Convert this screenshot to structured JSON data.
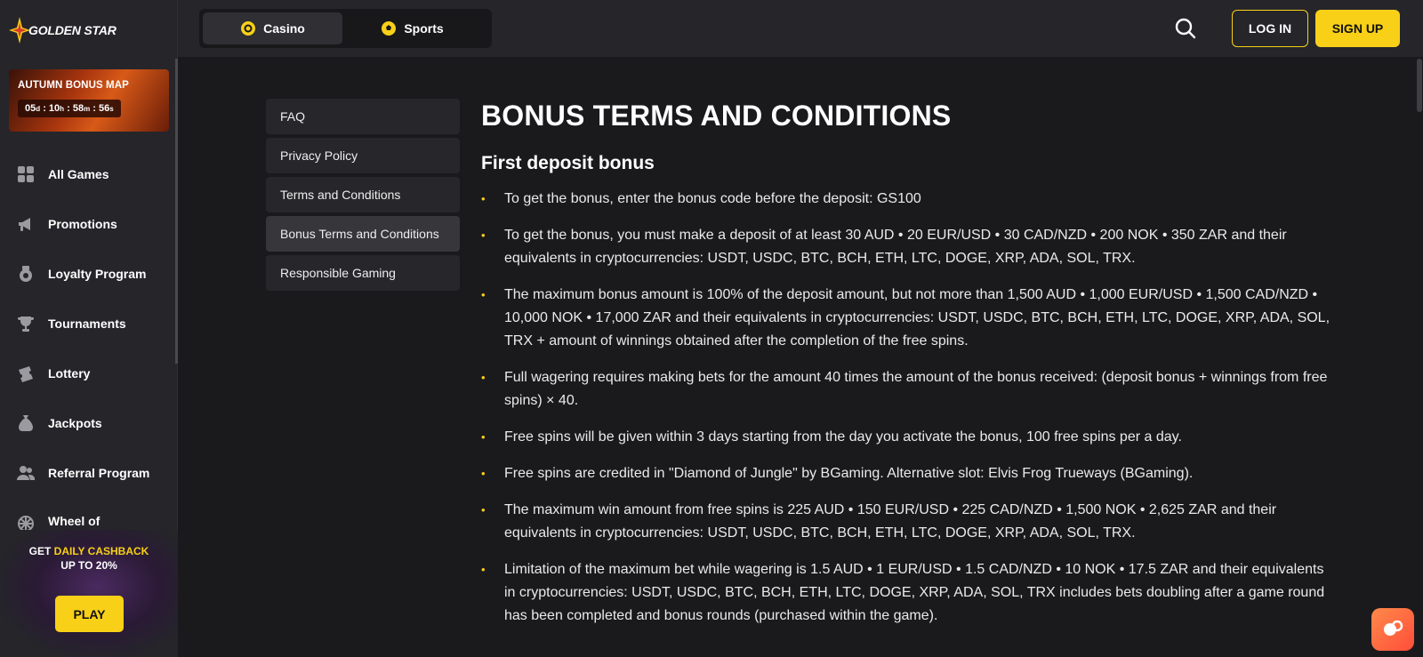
{
  "brand": {
    "name": "GOLDEN STAR",
    "accent": "#f8d017"
  },
  "promo": {
    "title": "AUTUMN BONUS MAP",
    "timer": {
      "d": "05",
      "h": "10",
      "m": "58",
      "s": "56"
    },
    "units": {
      "d": "d",
      "h": "h",
      "m": "m",
      "s": "s"
    }
  },
  "nav": [
    {
      "label": "All Games",
      "icon": "grid-icon"
    },
    {
      "label": "Promotions",
      "icon": "megaphone-icon"
    },
    {
      "label": "Loyalty Program",
      "icon": "medal-icon"
    },
    {
      "label": "Tournaments",
      "icon": "trophy-icon"
    },
    {
      "label": "Lottery",
      "icon": "ticket-icon"
    },
    {
      "label": "Jackpots",
      "icon": "money-bag-icon"
    },
    {
      "label": "Referral Program",
      "icon": "users-icon"
    },
    {
      "label": "Wheel of Fortune",
      "icon": "wheel-icon"
    }
  ],
  "cashback": {
    "line1_prefix": "GET",
    "line1_highlight": "DAILY CASHBACK",
    "line2": "UP TO 20%",
    "button": "PLAY"
  },
  "tabs": [
    {
      "label": "Casino",
      "icon": "casino-chip-icon"
    },
    {
      "label": "Sports",
      "icon": "soccer-ball-icon"
    }
  ],
  "header": {
    "login": "LOG IN",
    "signup": "SIGN UP"
  },
  "side_menu": [
    {
      "label": "FAQ"
    },
    {
      "label": "Privacy Policy"
    },
    {
      "label": "Terms and Conditions"
    },
    {
      "label": "Bonus Terms and Conditions"
    },
    {
      "label": "Responsible Gaming"
    }
  ],
  "content": {
    "title": "BONUS TERMS AND CONDITIONS",
    "section": "First deposit bonus",
    "rules": [
      "To get the bonus, enter the bonus code before the deposit: GS100",
      "To get the bonus, you must make a deposit of at least 30 AUD • 20 EUR/USD • 30 CAD/NZD • 200 NOK • 350 ZAR and their equivalents in cryptocurrencies: USDT, USDC, BTC, BCH, ETH, LTC, DOGE, XRP, ADA, SOL, TRX.",
      "The maximum bonus amount is 100% of the deposit amount, but not more than 1,500 AUD • 1,000 EUR/USD • 1,500 CAD/NZD • 10,000 NOK • 17,000 ZAR and their equivalents in cryptocurrencies: USDT, USDC, BTC, BCH, ETH, LTC, DOGE, XRP, ADA, SOL, TRX + amount of winnings obtained after the completion of the free spins.",
      "Full wagering requires making bets for the amount 40 times the amount of the bonus received: (deposit bonus + winnings from free spins) × 40.",
      "Free spins will be given within 3 days starting from the day you activate the bonus, 100 free spins per a day.",
      "Free spins are credited in \"Diamond of Jungle\" by BGaming. Alternative slot: Elvis Frog Trueways (BGaming).",
      "The maximum win amount from free spins is 225 AUD • 150 EUR/USD • 225 CAD/NZD • 1,500 NOK • 2,625 ZAR and their equivalents in cryptocurrencies: USDT, USDC, BTC, BCH, ETH, LTC, DOGE, XRP, ADA, SOL, TRX.",
      "Limitation of the maximum bet while wagering is 1.5 AUD • 1 EUR/USD • 1.5 CAD/NZD • 10 NOK • 17.5 ZAR and their equivalents in cryptocurrencies: USDT, USDC, BTC, BCH, ETH, LTC, DOGE, XRP, ADA, SOL, TRX includes bets doubling after a game round has been completed and bonus rounds (purchased within the game)."
    ]
  }
}
